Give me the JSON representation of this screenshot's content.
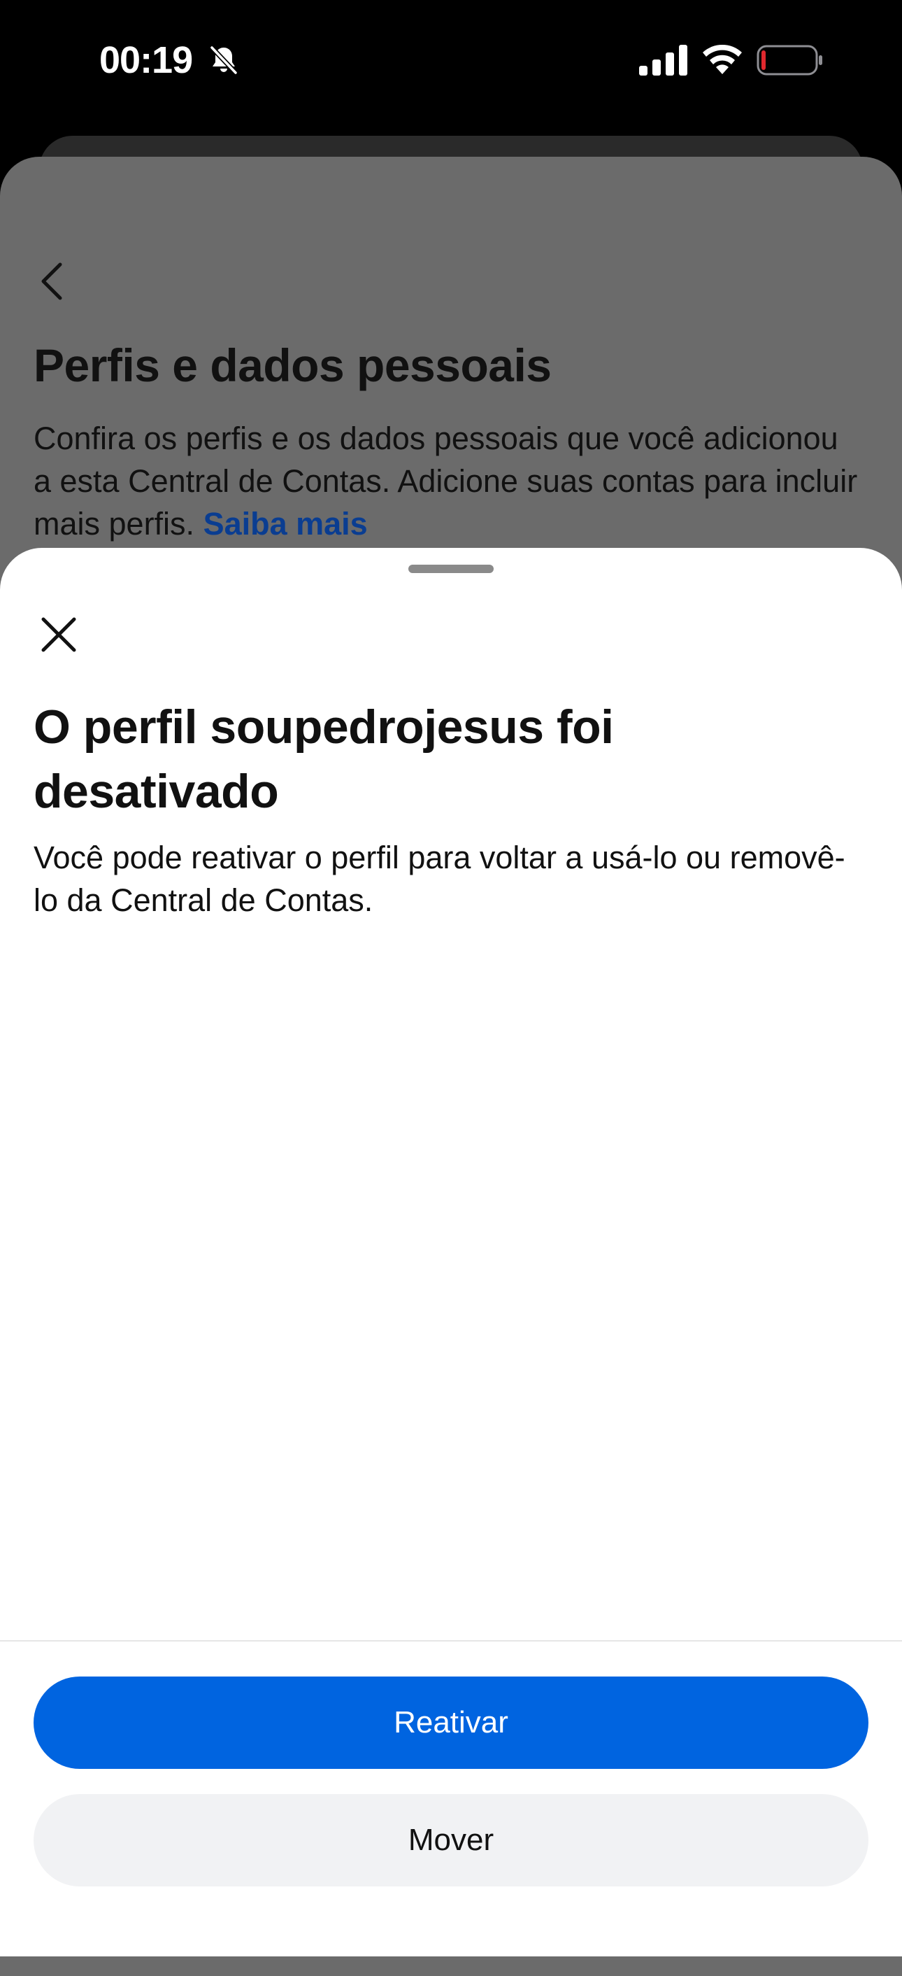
{
  "status_bar": {
    "time": "00:19",
    "icons": [
      "bell-slash-icon",
      "cellular-signal-icon",
      "wifi-icon",
      "battery-icon"
    ],
    "battery_level_percent": 5,
    "battery_level_color": "#e0282e"
  },
  "background_page": {
    "back_icon": "chevron-left-icon",
    "title": "Perfis e dados pessoais",
    "description": "Confira os perfis e os dados pessoais que você adicionou a esta Central de Contas. Adicione suas contas para incluir mais perfis.",
    "link_label": "Saiba mais",
    "overlay_color": "#6b6b6b"
  },
  "sheet": {
    "close_icon": "close-icon",
    "title": "O perfil soupedrojesus foi desativado",
    "description": "Você pode reativar o perfil para voltar a usá-lo ou removê-lo da Central de Contas.",
    "primary_button_label": "Reativar",
    "secondary_button_label": "Mover",
    "accent_color": "#0064e0",
    "secondary_button_color": "#f1f2f4"
  }
}
